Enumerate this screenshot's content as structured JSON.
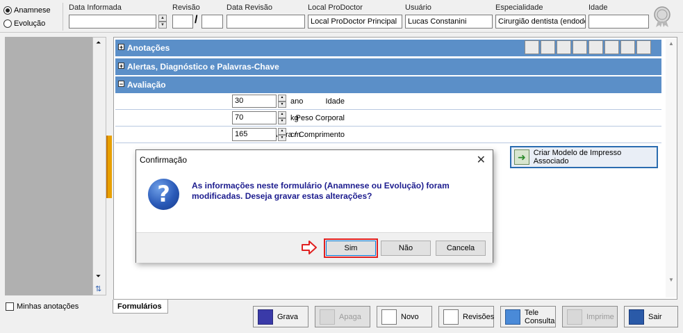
{
  "header": {
    "radio_anamnese": "Anamnese",
    "radio_evolucao": "Evolução",
    "data_informada_label": "Data Informada",
    "data_informada_value": "",
    "revisao_label": "Revisão",
    "revisao_value_1": "",
    "revisao_value_2": "",
    "data_revisao_label": "Data Revisão",
    "data_revisao_value": "",
    "local_label": "Local ProDoctor",
    "local_value": "Local ProDoctor Principal",
    "usuario_label": "Usuário",
    "usuario_value": "Lucas Constanini",
    "especialidade_label": "Especialidade",
    "especialidade_value": "Cirurgião dentista (endodo",
    "idade_label": "Idade",
    "idade_value": ""
  },
  "sidebar": {
    "minhas_label": "Minhas anotações"
  },
  "form": {
    "sections": [
      "Anotações",
      "Alertas, Diagnóstico e Palavras-Chave",
      "Avaliação"
    ],
    "section_toggles": [
      "+",
      "+",
      "−"
    ],
    "fields": [
      {
        "label": "Idade",
        "value": "30",
        "unit": "ano"
      },
      {
        "label": "Peso Corporal",
        "value": "70",
        "unit": "kg"
      },
      {
        "label": "Altura / Comprimento",
        "value": "165",
        "unit": "cm"
      }
    ],
    "criar_label": "Criar Modelo de Impresso Associado"
  },
  "tab": {
    "label": "Formulários"
  },
  "buttons": [
    {
      "label": "Grava",
      "enabled": true
    },
    {
      "label": "Apaga",
      "enabled": false
    },
    {
      "label": "Novo",
      "enabled": true
    },
    {
      "label": "Revisões",
      "enabled": true
    },
    {
      "label_1": "Tele",
      "label_2": "Consulta",
      "enabled": true
    },
    {
      "label": "Imprime",
      "enabled": false
    },
    {
      "label": "Sair",
      "enabled": true
    }
  ],
  "dialog": {
    "title": "Confirmação",
    "close_glyph": "✕",
    "icon_glyph": "?",
    "message": "As informações neste formulário (Anamnese ou Evolução) foram modificadas. Deseja gravar estas alterações?",
    "btn_sim": "Sim",
    "btn_nao": "Não",
    "btn_cancela": "Cancela"
  },
  "colors": {
    "section_blue": "#5b8fc8",
    "message_blue": "#1c1c8e",
    "highlight_red": "#e02020",
    "splitter_orange": "#e8a000"
  }
}
